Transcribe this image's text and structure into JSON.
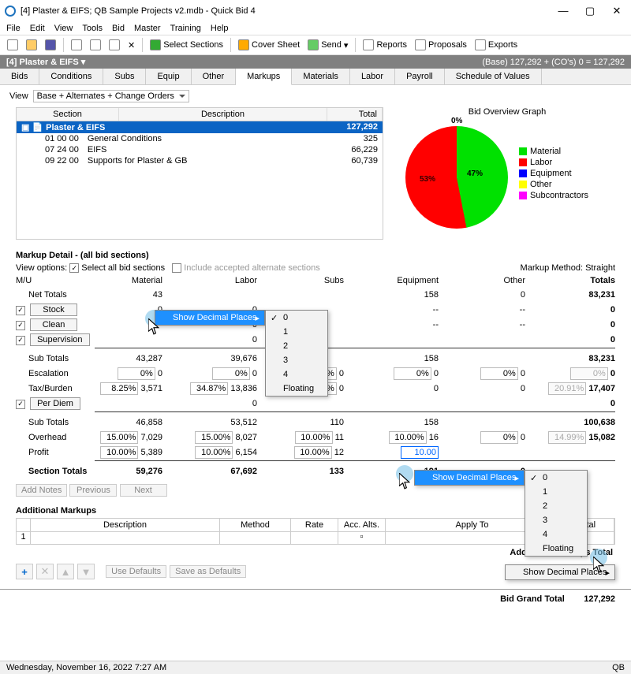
{
  "window": {
    "title": "[4] Plaster & EIFS; QB Sample Projects v2.mdb - Quick Bid 4"
  },
  "menubar": [
    "File",
    "Edit",
    "View",
    "Tools",
    "Bid",
    "Master",
    "Training",
    "Help"
  ],
  "toolbar": [
    "Select Sections",
    "Cover Sheet",
    "Send",
    "Reports",
    "Proposals",
    "Exports"
  ],
  "bidbar": {
    "left": "[4] Plaster & EIFS ▾",
    "right": "(Base) 127,292 + (CO's) 0 = 127,292"
  },
  "tabs": [
    "Bids",
    "Conditions",
    "Subs",
    "Equip",
    "Other",
    "Markups",
    "Materials",
    "Labor",
    "Payroll",
    "Schedule of Values"
  ],
  "active_tab": 5,
  "view_label": "View",
  "view_value": "Base + Alternates + Change Orders",
  "chart_title": "Bid Overview Graph",
  "grid": {
    "headers": [
      "Section",
      "Description",
      "Total"
    ],
    "rows": [
      {
        "sel": true,
        "section": "Plaster & EIFS",
        "desc": "",
        "total": "127,292"
      },
      {
        "sel": false,
        "section": "01 00 00",
        "desc": "General Conditions",
        "total": "325"
      },
      {
        "sel": false,
        "section": "07 24 00",
        "desc": "EIFS",
        "total": "66,229"
      },
      {
        "sel": false,
        "section": "09 22 00",
        "desc": "Supports for Plaster & GB",
        "total": "60,739"
      }
    ]
  },
  "legend": [
    {
      "color": "#00e100",
      "label": "Material"
    },
    {
      "color": "#ff0000",
      "label": "Labor"
    },
    {
      "color": "#0000ff",
      "label": "Equipment"
    },
    {
      "color": "#ffff00",
      "label": "Other"
    },
    {
      "color": "#ff00ff",
      "label": "Subcontractors"
    }
  ],
  "chart_data": {
    "type": "pie",
    "title": "Bid Overview Graph",
    "series": [
      {
        "name": "Material",
        "value": 47,
        "color": "#00e100"
      },
      {
        "name": "Labor",
        "value": 53,
        "color": "#ff0000"
      },
      {
        "name": "Equipment",
        "value": 0,
        "color": "#0000ff"
      },
      {
        "name": "Other",
        "value": 0,
        "color": "#ffff00"
      },
      {
        "name": "Subcontractors",
        "value": 0,
        "color": "#ff00ff"
      }
    ],
    "annotations": [
      "0%",
      "47%",
      "53%"
    ]
  },
  "markup": {
    "title": "Markup Detail - (all bid sections)",
    "view_opts_label": "View options:",
    "select_all": "Select all bid sections",
    "include_alt": "Include accepted alternate sections",
    "method_label": "Markup Method: Straight",
    "cols": [
      "M/U",
      "Material",
      "Labor",
      "Subs",
      "Equipment",
      "Other",
      "Totals"
    ],
    "rows": {
      "net": {
        "label": "Net Totals",
        "mat": "43",
        "lab": "",
        "sub": "",
        "eq": "158",
        "oth": "0",
        "tot": "83,231"
      },
      "stock": {
        "label": "Stock",
        "mat": "0",
        "lab": "0",
        "sub": "",
        "eq": "--",
        "oth": "--",
        "tot": "0"
      },
      "clean": {
        "label": "Clean",
        "mat": "",
        "lab": "0",
        "sub": "",
        "eq": "--",
        "oth": "--",
        "tot": "0"
      },
      "supervision": {
        "label": "Supervision",
        "mat": "",
        "lab": "0",
        "sub": "",
        "eq": "",
        "oth": "",
        "tot": "0"
      },
      "sub1": {
        "label": "Sub Totals",
        "mat": "43,287",
        "lab": "39,676",
        "sub": "",
        "eq": "158",
        "oth": "",
        "tot": "83,231"
      },
      "esc": {
        "label": "Escalation",
        "mpct": "0%",
        "mat": "0",
        "lpct": "0%",
        "lab": "0",
        "spct": "0%",
        "sub": "0",
        "epct": "0%",
        "eq": "0",
        "opct": "0%",
        "oth": "0",
        "xpct": "0%",
        "tot": "0"
      },
      "tax": {
        "label": "Tax/Burden",
        "mpct": "8.25%",
        "mat": "3,571",
        "lpct": "34.87%",
        "lab": "13,836",
        "spct": "0%",
        "sub": "0",
        "epct": "",
        "eq": "0",
        "opct": "",
        "oth": "0",
        "xpct": "20.91%",
        "tot": "17,407"
      },
      "perdiem": {
        "label": "Per Diem",
        "mat": "",
        "lab": "0",
        "sub": "",
        "eq": "",
        "oth": "",
        "tot": "0"
      },
      "sub2": {
        "label": "Sub Totals",
        "mat": "46,858",
        "lab": "53,512",
        "sub": "110",
        "eq": "158",
        "oth": "",
        "tot": "100,638"
      },
      "ovh": {
        "label": "Overhead",
        "mpct": "15.00%",
        "mat": "7,029",
        "lpct": "15.00%",
        "lab": "8,027",
        "spct": "10.00%",
        "sub": "11",
        "epct": "10.00%",
        "eq": "16",
        "opct": "0%",
        "oth": "0",
        "xpct": "14.99%",
        "tot": "15,082"
      },
      "profit": {
        "label": "Profit",
        "mpct": "10.00%",
        "mat": "5,389",
        "lpct": "10.00%",
        "lab": "6,154",
        "spct": "10.00%",
        "sub": "12",
        "epct": "10.00",
        "eq": "",
        "opct": "",
        "oth": "",
        "xpct": "",
        "tot": ""
      },
      "sect": {
        "label": "Section Totals",
        "mat": "59,276",
        "lab": "67,692",
        "sub": "133",
        "eq": "191",
        "oth": "0",
        "tot": ""
      }
    },
    "buttons": {
      "add": "Add Notes",
      "prev": "Previous",
      "next": "Next"
    }
  },
  "context_menu": {
    "label": "Show Decimal Places",
    "options": [
      "0",
      "1",
      "2",
      "3",
      "4",
      "Floating"
    ],
    "checked": "0"
  },
  "context_menu2": {
    "label": "Show Decimal Places"
  },
  "addl": {
    "title": "Additional Markups",
    "headers": [
      "",
      "Description",
      "Method",
      "Rate",
      "Acc. Alts.",
      "Apply To",
      "Total"
    ],
    "row1": "1",
    "total_label": "Additional Markups Total",
    "defaults1": "Use Defaults",
    "defaults2": "Save as Defaults"
  },
  "grand": {
    "label": "Bid Grand Total",
    "value": "127,292"
  },
  "status": {
    "left": "Wednesday, November 16, 2022 7:27 AM",
    "right": "QB"
  }
}
